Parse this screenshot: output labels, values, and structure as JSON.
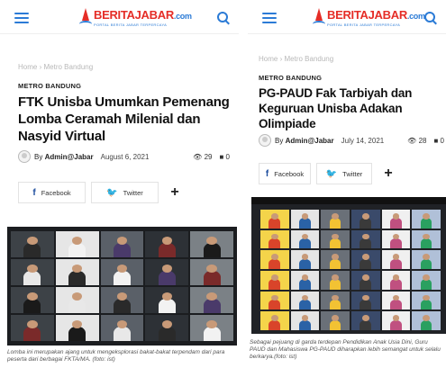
{
  "left": {
    "site": {
      "brand_main": "BERITAJABAR",
      "brand_tld": ".com",
      "tagline": "PORTAL BERITA JABAR TERPERCAYA"
    },
    "breadcrumb": {
      "home": "Home",
      "sep": "›",
      "section": "Metro Bandung"
    },
    "category": "METRO BANDUNG",
    "title": "FTK Unisba Umumkan Pemenang Lomba Ceramah Milenial dan Nasyid Virtual",
    "author_prefix": "By",
    "author": "Admin@Jabar",
    "date": "August 6, 2021",
    "views": "29",
    "comments": "0",
    "share": {
      "facebook": "Facebook",
      "twitter": "Twitter",
      "more": "+"
    },
    "caption": "Lomba ini merupakan ajang untuk mengeksplorasi bakat-bakat terpendam dari para peserta dari berbagai FKTA/MA. (foto: ist)"
  },
  "right": {
    "site": {
      "brand_main": "BERITAJABAR",
      "brand_tld": ".com",
      "tagline": "PORTAL BERITA JABAR TERPERCAYA"
    },
    "breadcrumb": {
      "home": "Home",
      "sep": "›",
      "section": "Metro Bandung"
    },
    "category": "METRO BANDUNG",
    "title": "PG-PAUD Fak Tarbiyah dan Keguruan Unisba Adakan Olimpiade",
    "author_prefix": "By",
    "author": "Admin@Jabar",
    "date": "July 14, 2021",
    "views": "28",
    "comments": "0",
    "share": {
      "facebook": "Facebook",
      "twitter": "Twitter",
      "more": "+"
    },
    "caption": "Sebagai pejuang di garda terdepan Pendidikan Anak Usia Dini, Guru PAUD dan Mahasiswa PG-PAUD diharapkan lebih semangat untuk selalu berkarya.(foto: ist)"
  },
  "colors": {
    "brand_red": "#e52d27",
    "brand_blue": "#2b7bd6",
    "facebook": "#1d4d9e",
    "twitter": "#2b9be9"
  },
  "icons": {
    "menu": "hamburger-icon",
    "search": "search-icon",
    "views": "eye-icon",
    "comments": "comment-icon"
  }
}
